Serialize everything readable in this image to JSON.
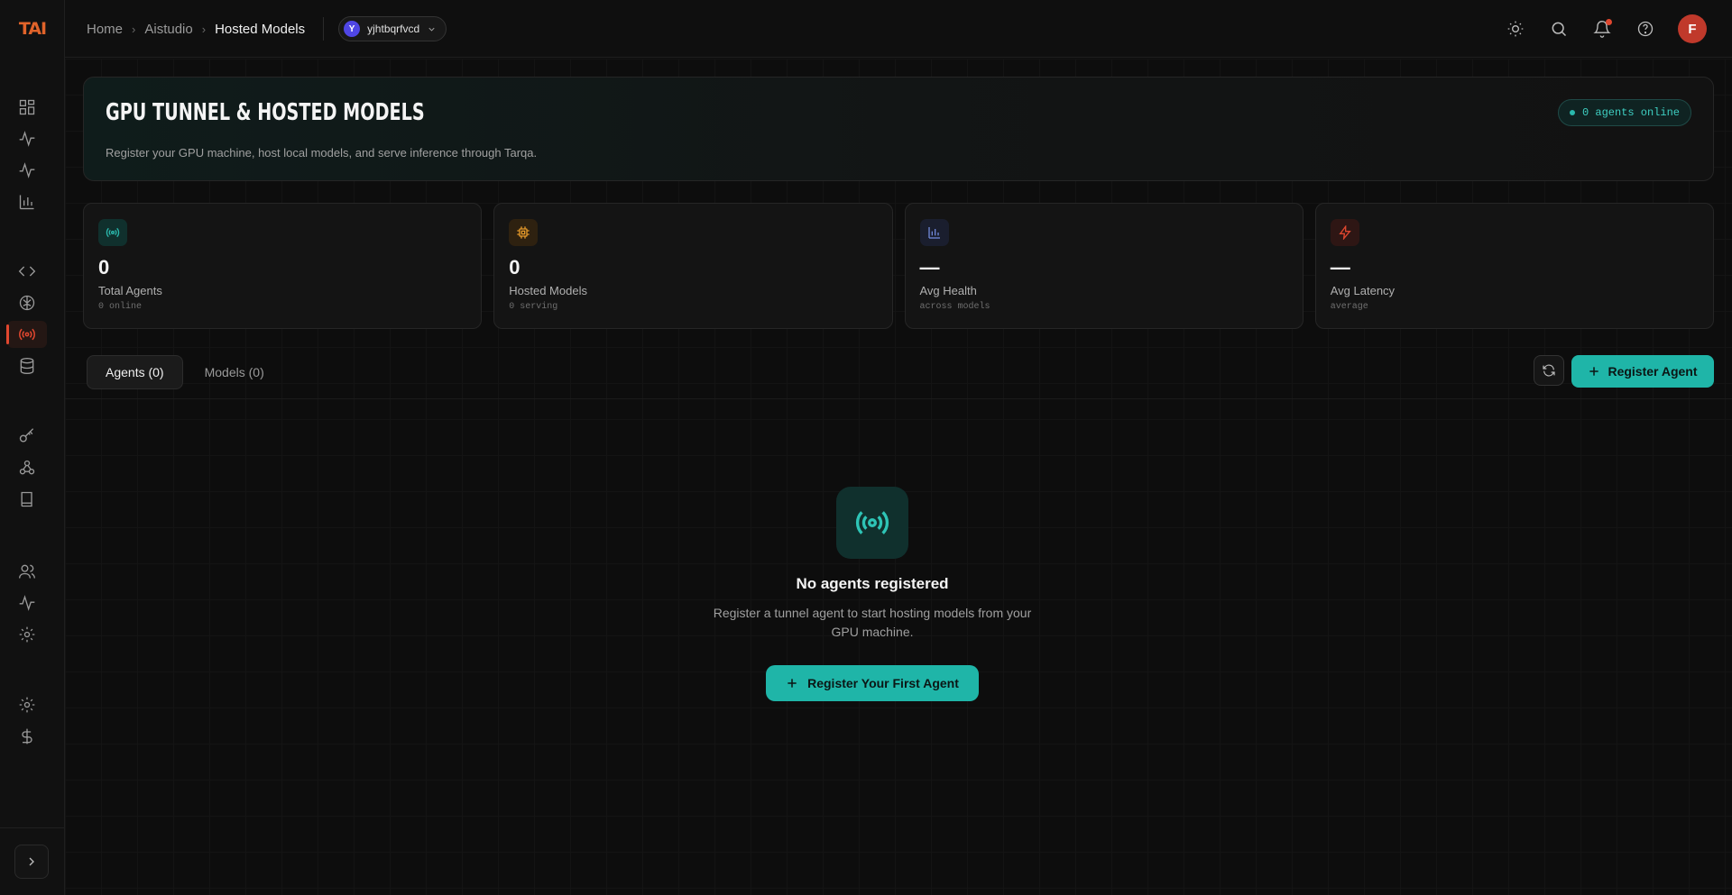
{
  "app": {
    "logo": "TAI"
  },
  "breadcrumb": {
    "items": [
      "Home",
      "Aistudio",
      "Hosted Models"
    ]
  },
  "workspace": {
    "initial": "Y",
    "name": "yjhtbqrfvcd"
  },
  "user": {
    "initial": "F"
  },
  "hero": {
    "title": "GPU TUNNEL & HOSTED MODELS",
    "subtitle": "Register your GPU machine, host local models, and serve inference through Tarqa.",
    "online_badge": "0 agents online"
  },
  "stats": [
    {
      "icon": "signal-icon",
      "value": "0",
      "label": "Total Agents",
      "sub": "0 online",
      "color": "#2ab8ac"
    },
    {
      "icon": "chip-icon",
      "value": "0",
      "label": "Hosted Models",
      "sub": "0 serving",
      "color": "#e69a2a"
    },
    {
      "icon": "bar-chart-icon",
      "value": "—",
      "label": "Avg Health",
      "sub": "across models",
      "color": "#6f86d6"
    },
    {
      "icon": "lightning-icon",
      "value": "—",
      "label": "Avg Latency",
      "sub": "average",
      "color": "#e0472f"
    }
  ],
  "tabs": [
    {
      "label": "Agents (0)",
      "active": true
    },
    {
      "label": "Models (0)",
      "active": false
    }
  ],
  "actions": {
    "register_label": "Register Agent"
  },
  "empty_state": {
    "title": "No agents registered",
    "description": "Register a tunnel agent to start hosting models from your GPU machine.",
    "button_label": "Register Your First Agent"
  },
  "colors": {
    "accent": "#1fb5a8",
    "brand": "#e0632a",
    "active_nav": "#e0472f"
  }
}
